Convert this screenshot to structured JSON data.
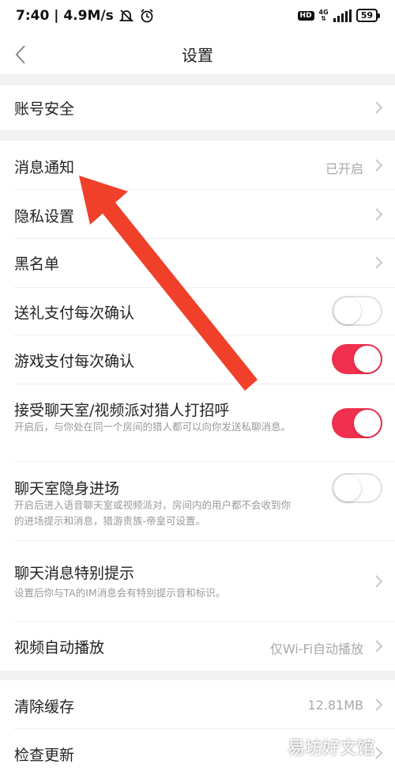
{
  "status_bar": {
    "time_speed": "7:40 | 4.9M/s",
    "network": "4G",
    "battery": "59",
    "hd": "HD"
  },
  "header": {
    "title": "设置"
  },
  "rows": {
    "account": {
      "label": "账号安全"
    },
    "notifications": {
      "label": "消息通知",
      "value": "已开启"
    },
    "privacy": {
      "label": "隐私设置"
    },
    "blacklist": {
      "label": "黑名单"
    },
    "gift_confirm": {
      "label": "送礼支付每次确认",
      "toggle": "off"
    },
    "game_confirm": {
      "label": "游戏支付每次确认",
      "toggle": "on"
    },
    "greeting": {
      "label": "接受聊天室/视频派对猎人打招呼",
      "sub": "开启后，与你处在同一个房间的猎人都可以向你发送私聊消息。",
      "toggle": "on"
    },
    "stealth": {
      "label": "聊天室隐身进场",
      "sub": "开启后进入语音聊天室或视频派对，房间内的用户都不会收到你的进场提示和消息，猎游贵族-帝皇可设置。",
      "toggle": "off"
    },
    "special_alert": {
      "label": "聊天消息特别提示",
      "sub": "设置后你与TA的IM消息会有特别提示音和标识。"
    },
    "autoplay": {
      "label": "视频自动播放",
      "value": "仅Wi-Fi自动播放"
    },
    "cache": {
      "label": "清除缓存",
      "value": "12.81MB"
    },
    "update": {
      "label": "检查更新"
    }
  },
  "watermark": "易坊好文馆",
  "colors": {
    "accent": "#f0304e",
    "arrow": "#f0402a",
    "background": "#f2f2f2"
  }
}
